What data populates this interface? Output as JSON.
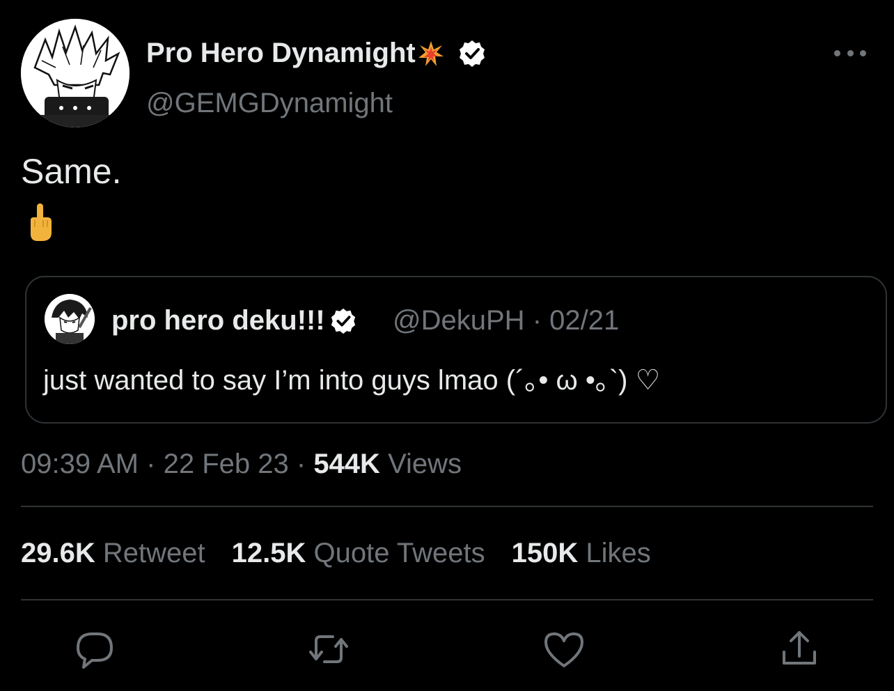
{
  "author": {
    "display_name": "Pro Hero Dynamight",
    "name_emoji": "collision-emoji",
    "handle": "@GEMGDynamight",
    "verified": true
  },
  "tweet": {
    "text": "Same.",
    "emoji": "middle-finger-emoji"
  },
  "quoted_tweet": {
    "display_name": "pro hero deku!!!",
    "handle": "@DekuPH",
    "separator": "·",
    "date": "02/21",
    "text": "just wanted to say I’m into guys lmao (´｡• ω •｡`) ♡",
    "verified": true
  },
  "meta": {
    "time": "09:39 AM",
    "date": "22 Feb 23",
    "views_count": "544K",
    "views_label": "Views"
  },
  "stats": {
    "retweets": {
      "count": "29.6K",
      "label": "Retweet"
    },
    "quotes": {
      "count": "12.5K",
      "label": "Quote Tweets"
    },
    "likes": {
      "count": "150K",
      "label": "Likes"
    }
  },
  "actions": [
    "reply-icon",
    "retweet-icon",
    "like-icon",
    "share-icon"
  ],
  "colors": {
    "background": "#000000",
    "text_primary": "#e7e9ea",
    "text_secondary": "#71767b",
    "border": "#2f3336"
  }
}
